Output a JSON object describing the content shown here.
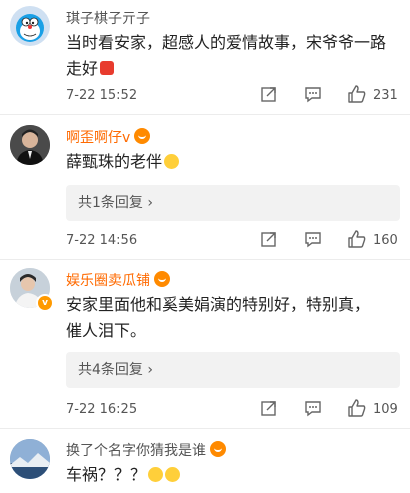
{
  "comments": [
    {
      "username": "琪子棋子亓子",
      "text": "当时看安家，超感人的爱情故事，宋爷爷一路走好",
      "time": "7-22 15:52",
      "likes": "231"
    },
    {
      "username": "啊歪啊仔v",
      "text": "薛甄珠的老伴",
      "replies": "共1条回复 ›",
      "time": "7-22 14:56",
      "likes": "160"
    },
    {
      "username": "娱乐圈卖瓜铺",
      "text_line1": "安家里面他和奚美娟演的特别好，特别真，",
      "text_line2": "催人泪下。",
      "replies": "共4条回复 ›",
      "time": "7-22 16:25",
      "likes": "109"
    },
    {
      "username": "换了个名字你猜我是谁",
      "text": "车祸？？？"
    }
  ],
  "icons": {
    "share": "share-icon",
    "comment": "comment-icon",
    "like": "thumbs-up-icon"
  },
  "colors": {
    "vip_name": "#ff6a00",
    "normal_name": "#555555",
    "badge": "#ff9a00"
  }
}
